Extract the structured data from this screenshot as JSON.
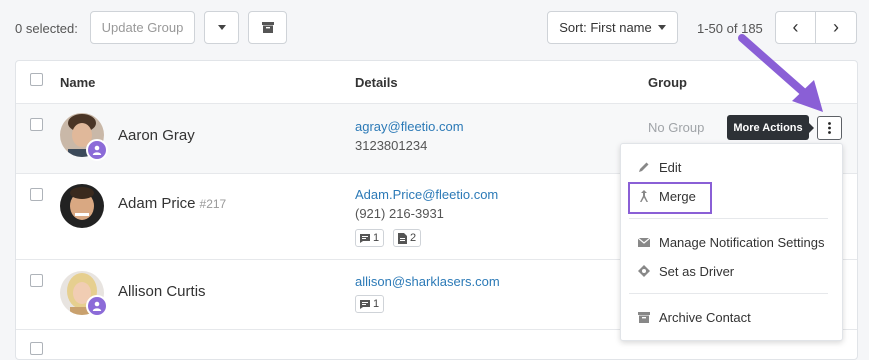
{
  "toolbar": {
    "selected_text": "0 selected:",
    "update_group_label": "Update Group",
    "sort_label": "Sort: First name",
    "pagination_text": "1-50 of 185",
    "prev_glyph": "‹",
    "next_glyph": "›"
  },
  "table": {
    "headers": {
      "name": "Name",
      "details": "Details",
      "group": "Group"
    },
    "rows": [
      {
        "name": "Aaron Gray",
        "number": "",
        "email": "agray@fleetio.com",
        "phone": "3123801234",
        "group": "No Group",
        "comments": "",
        "documents": ""
      },
      {
        "name": "Adam Price",
        "number": "#217",
        "email": "Adam.Price@fleetio.com",
        "phone": "(921) 216-3931",
        "group": "",
        "comments": "1",
        "documents": "2"
      },
      {
        "name": "Allison Curtis",
        "number": "",
        "email": "allison@sharklasers.com",
        "phone": "",
        "group": "",
        "comments": "1",
        "documents": ""
      }
    ]
  },
  "tooltip": "More Actions",
  "menu": {
    "items": [
      {
        "label": "Edit",
        "icon": "pencil-icon"
      },
      {
        "label": "Merge",
        "icon": "merge-icon"
      },
      {
        "label": "Manage Notification Settings",
        "icon": "envelope-icon"
      },
      {
        "label": "Set as Driver",
        "icon": "steering-icon"
      },
      {
        "label": "Archive Contact",
        "icon": "archive-icon"
      }
    ]
  },
  "colors": {
    "accent": "#8a5fd6",
    "link": "#2c7ab7",
    "badge": "#8c6bd8"
  }
}
